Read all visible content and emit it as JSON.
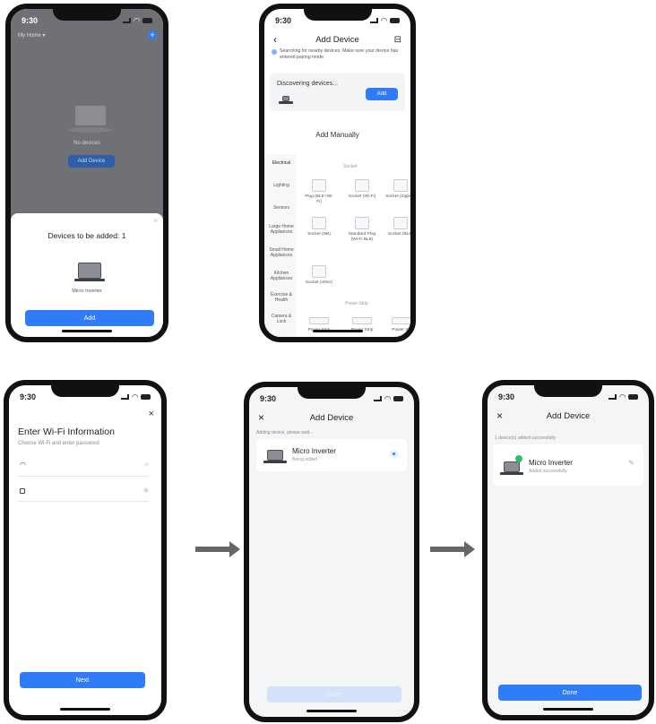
{
  "status_time": "9:30",
  "arrow_color": "#666666",
  "accent": "#2f7cf6",
  "phone1": {
    "top_label": "My Home",
    "bg_device_label": "No devices",
    "bg_add_button": "Add Device",
    "sheet_title": "Devices to be added: 1",
    "device_name": "Micro Inverter",
    "add_button": "Add",
    "close_icon": "close-icon"
  },
  "phone2": {
    "title": "Add Device",
    "bluetooth_notice": "Searching for nearby devices. Make sure your device has entered pairing mode",
    "discovering": "Discovering devices...",
    "add_button": "Add",
    "add_manually": "Add Manually",
    "sidebar": [
      "Electrical",
      "Lighting",
      "Sensors",
      "Large Home Appliances",
      "Small Home Appliances",
      "Kitchen Appliances",
      "Exercise & Health",
      "Camera & Lock"
    ],
    "section_socket": "Socket",
    "tiles_row1": [
      "Plug (BLE+Wi-Fi)",
      "Socket (Wi-Fi)",
      "Socket (Zigbee)"
    ],
    "tiles_row2": [
      "Socket (NB)",
      "Standard Plug (Wi-Fi BLE)",
      "Socket (BLE)"
    ],
    "tiles_row3": [
      "Socket (other)"
    ],
    "section_powerstrip": "Power Strip",
    "strip_labels": [
      "Power Strip",
      "Power Strip",
      "Power St"
    ]
  },
  "phone3": {
    "title": "Enter Wi-Fi Information",
    "subtitle": "Choose Wi-Fi and enter password",
    "wifi_field": "",
    "password_field": "",
    "next_button": "Next"
  },
  "phone4": {
    "title": "Add Device",
    "notice": "Adding device, please wait...",
    "device_name": "Micro Inverter",
    "device_status": "Being added",
    "done_button": "Done"
  },
  "phone5": {
    "title": "Add Device",
    "notice": "1 device(s) added successfully",
    "device_name": "Micro Inverter",
    "device_status": "Added successfully",
    "done_button": "Done"
  }
}
